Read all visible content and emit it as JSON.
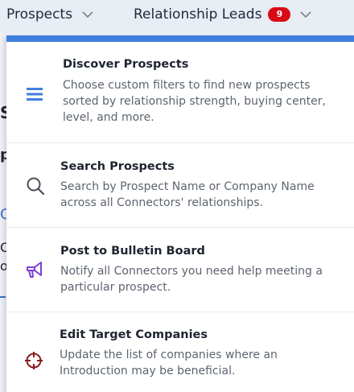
{
  "topnav": {
    "prospects_label": "Prospects",
    "leads_label": "Relationship Leads",
    "leads_count": "9"
  },
  "menu": {
    "items": [
      {
        "title": "Discover Prospects",
        "description": "Choose custom filters to find new prospects sorted by relationship strength, buying center, level, and more.",
        "icon": "menu-lines-icon",
        "icon_color": "#3f7fe0"
      },
      {
        "title": "Search Prospects",
        "description": "Search by Prospect Name or Company Name across all Connectors' relationships.",
        "icon": "search-icon",
        "icon_color": "#4a4f58"
      },
      {
        "title": "Post to Bulletin Board",
        "description": "Notify all Connectors you need help meeting a particular prospect.",
        "icon": "megaphone-icon",
        "icon_color": "#7b3fd6"
      },
      {
        "title": "Edit Target Companies",
        "description": "Update the list of companies where an Introduction may be beneficial.",
        "icon": "crosshair-icon",
        "icon_color": "#8a1c1c"
      }
    ]
  },
  "background": {
    "fragments": [
      "S",
      "p",
      "C",
      "C",
      "o"
    ]
  }
}
